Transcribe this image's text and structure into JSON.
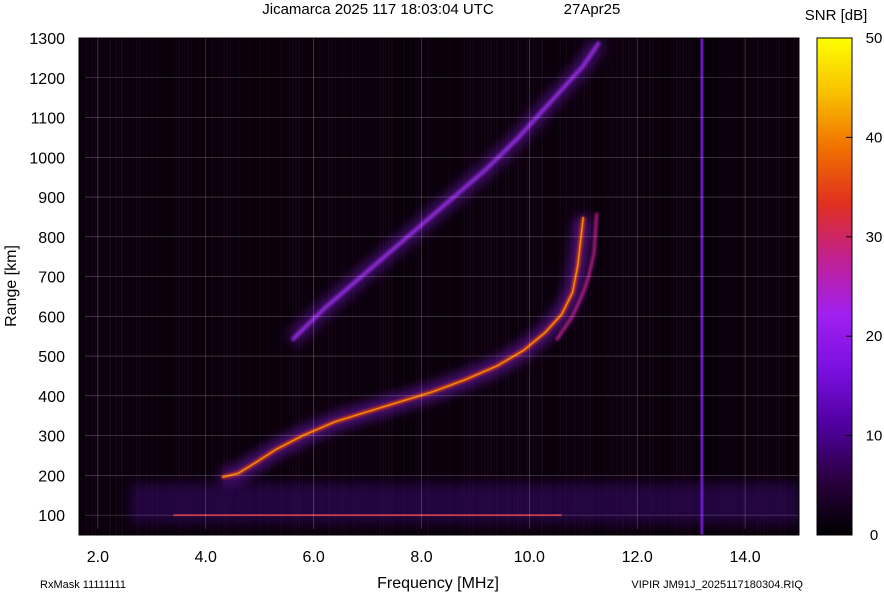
{
  "header": {
    "title": "Jicamarca 2025 117 18:03:04 UTC",
    "date": "27Apr25"
  },
  "footer": {
    "rxmask": "RxMask 11111111",
    "file": "VIPIR  JM91J_2025117180304.RIQ"
  },
  "colorbar": {
    "label": "SNR [dB]",
    "ticks": [
      0,
      10,
      20,
      30,
      40,
      50
    ]
  },
  "chart_data": {
    "type": "heatmap",
    "xlabel": "Frequency [MHz]",
    "ylabel": "Range [km]",
    "xlim": [
      1.65,
      15.0
    ],
    "ylim": [
      50,
      1300
    ],
    "xticks": [
      "2.0",
      "4.0",
      "6.0",
      "8.0",
      "10.0",
      "12.0",
      "14.0"
    ],
    "yticks": [
      100,
      200,
      300,
      400,
      500,
      600,
      700,
      800,
      900,
      1000,
      1100,
      1200,
      1300
    ],
    "zlim": [
      0,
      50
    ],
    "grid": true,
    "colormap": [
      "#000000",
      "#2a0040",
      "#5000a0",
      "#7a10e0",
      "#a020f0",
      "#c02090",
      "#e03020",
      "#f07000",
      "#f8c000",
      "#ffff00"
    ],
    "traces": {
      "o_mode_1hop": {
        "freq": [
          4.3,
          4.6,
          4.9,
          5.3,
          5.8,
          6.4,
          7.0,
          7.6,
          8.2,
          8.8,
          9.4,
          9.9,
          10.3,
          10.6,
          10.8,
          10.9,
          11.0
        ],
        "range": [
          195,
          205,
          230,
          265,
          300,
          335,
          360,
          385,
          410,
          440,
          475,
          515,
          560,
          605,
          660,
          730,
          850
        ]
      },
      "x_mode_1hop": {
        "freq": [
          10.5,
          10.8,
          11.0,
          11.1,
          11.2,
          11.25
        ],
        "range": [
          540,
          600,
          660,
          700,
          760,
          860
        ]
      },
      "multihop_2hop": {
        "freq": [
          5.6,
          6.2,
          6.8,
          7.4,
          8.0,
          8.6,
          9.2,
          9.8,
          10.2,
          10.6,
          11.0,
          11.3
        ],
        "range": [
          540,
          620,
          690,
          760,
          830,
          900,
          970,
          1050,
          1110,
          1170,
          1230,
          1290
        ]
      },
      "ground_echo_range_km": 100,
      "interference_lines_mhz": [
        13.2
      ]
    }
  }
}
